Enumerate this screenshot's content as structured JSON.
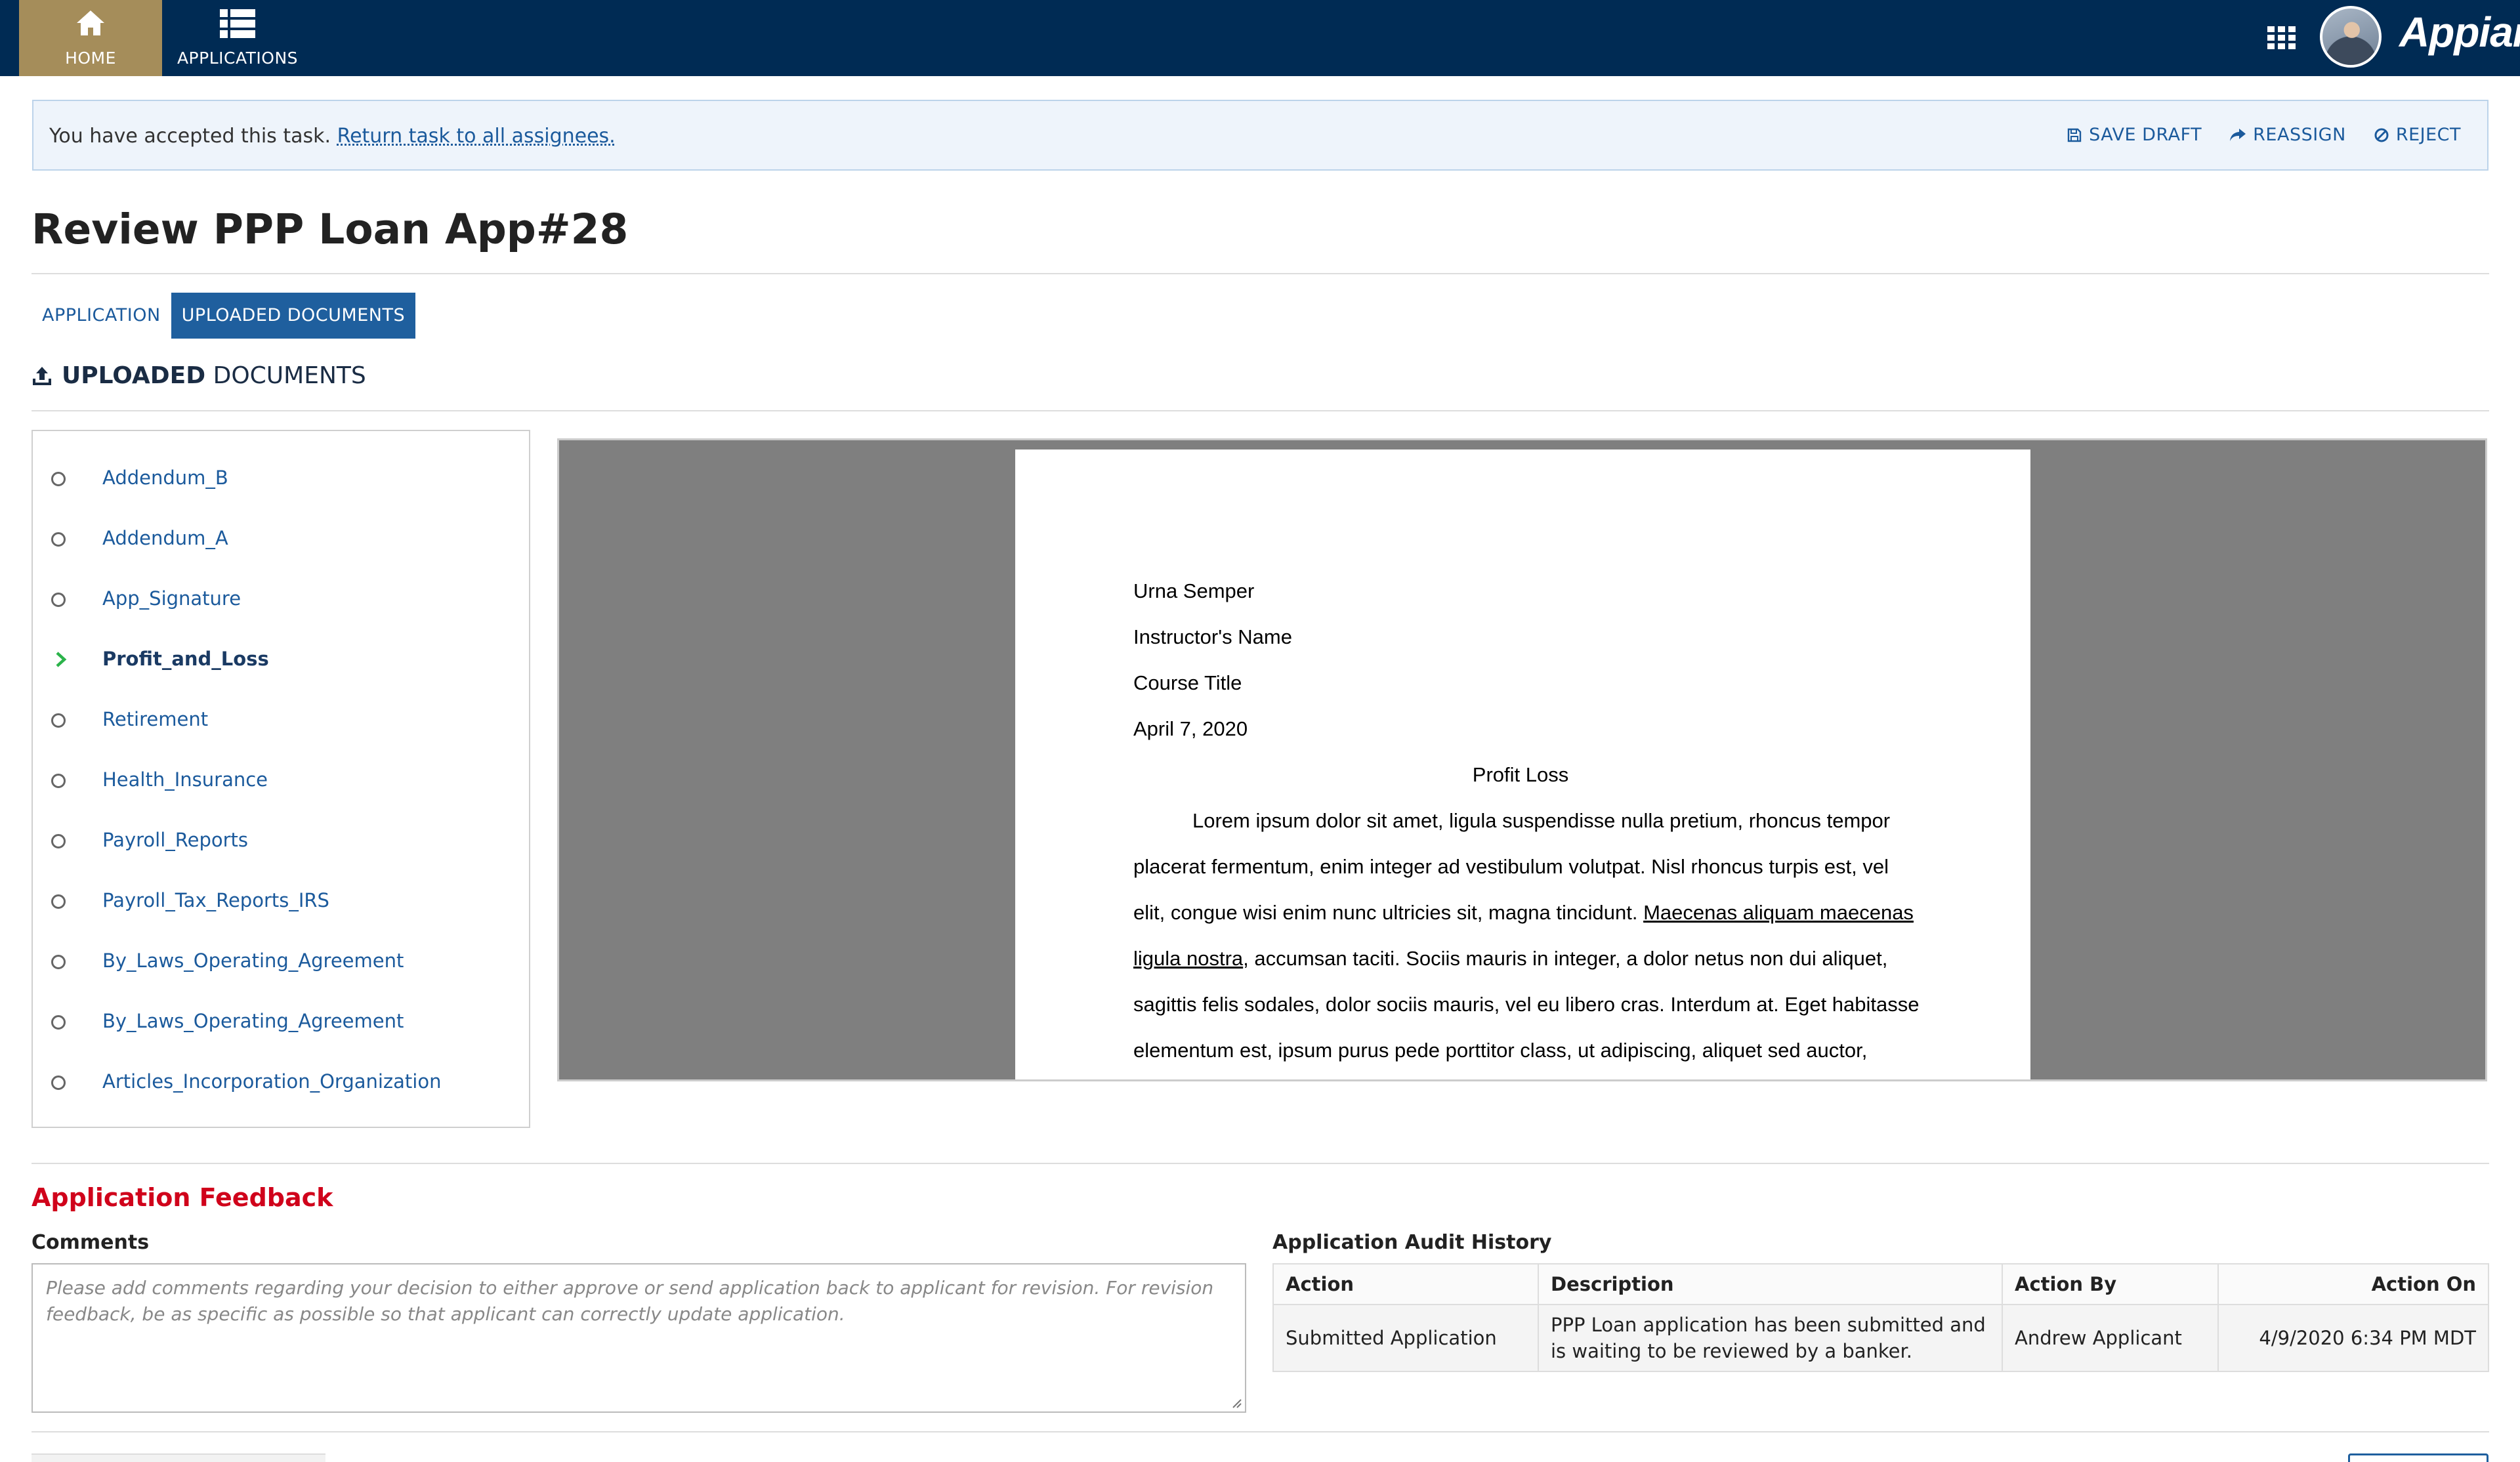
{
  "nav": {
    "home_label": "HOME",
    "applications_label": "APPLICATIONS",
    "brand": "Appian",
    "icons": {
      "home": "home-icon",
      "applications": "list-icon",
      "app_grid": "grid-icon"
    }
  },
  "banner": {
    "message": "You have accepted this task.",
    "link": "Return task to all assignees.",
    "actions": {
      "save_draft": "SAVE DRAFT",
      "reassign": "REASSIGN",
      "reject": "REJECT"
    }
  },
  "page": {
    "title": "Review PPP Loan App#28"
  },
  "tabs": [
    {
      "label": "APPLICATION",
      "active": false
    },
    {
      "label": "UPLOADED DOCUMENTS",
      "active": true
    }
  ],
  "section": {
    "title_bold": "UPLOADED",
    "title_rest": "DOCUMENTS"
  },
  "documents": [
    {
      "label": "Addendum_B",
      "selected": false
    },
    {
      "label": "Addendum_A",
      "selected": false
    },
    {
      "label": "App_Signature",
      "selected": false
    },
    {
      "label": "Profit_and_Loss",
      "selected": true
    },
    {
      "label": "Retirement",
      "selected": false
    },
    {
      "label": "Health_Insurance",
      "selected": false
    },
    {
      "label": "Payroll_Reports",
      "selected": false
    },
    {
      "label": "Payroll_Tax_Reports_IRS",
      "selected": false
    },
    {
      "label": "By_Laws_Operating_Agreement",
      "selected": false
    },
    {
      "label": "By_Laws_Operating_Agreement",
      "selected": false
    },
    {
      "label": "Articles_Incorporation_Organization",
      "selected": false
    }
  ],
  "viewer": {
    "header": [
      "Urna Semper",
      "Instructor's Name",
      "Course Title",
      "April 7, 2020"
    ],
    "heading": "Profit Loss",
    "body": {
      "l1": "Lorem ipsum dolor sit amet, ligula suspendisse nulla pretium, rhoncus tempor",
      "l2": "placerat fermentum, enim integer ad vestibulum volutpat. Nisl rhoncus turpis est, vel",
      "l3a": "elit, congue wisi enim nunc ultricies sit, magna tincidunt. ",
      "l3b": "Maecenas aliquam maecenas",
      "l4a": "ligula nostra",
      "l4b": ", accumsan taciti. Sociis mauris in integer, a dolor netus non dui aliquet,",
      "l5": "sagittis felis sodales, dolor sociis mauris, vel eu libero cras. Interdum at. Eget habitasse",
      "l6": "elementum est, ipsum purus pede porttitor class, ut adipiscing, aliquet sed auctor,"
    }
  },
  "feedback": {
    "title": "Application Feedback",
    "comments_label": "Comments",
    "comments_placeholder": "Please add comments regarding your decision to either approve or send application back to applicant for revision. For revision feedback, be as specific as possible so that applicant can correctly update application.",
    "comments_value": ""
  },
  "audit": {
    "title": "Application Audit History",
    "columns": [
      "Action",
      "Description",
      "Action By",
      "Action On"
    ],
    "rows": [
      [
        "Submitted Application",
        "PPP Loan application has been submitted and is waiting to be reviewed by a banker.",
        "Andrew Applicant",
        "4/9/2020 6:34 PM MDT"
      ]
    ]
  },
  "colors": {
    "nav_bg": "#002b54",
    "nav_active": "#a58d5a",
    "link": "#1b5a9c",
    "tab_active": "#1f5f9e",
    "feedback_title": "#d0021b",
    "selected_chevron": "#2bb34a"
  }
}
